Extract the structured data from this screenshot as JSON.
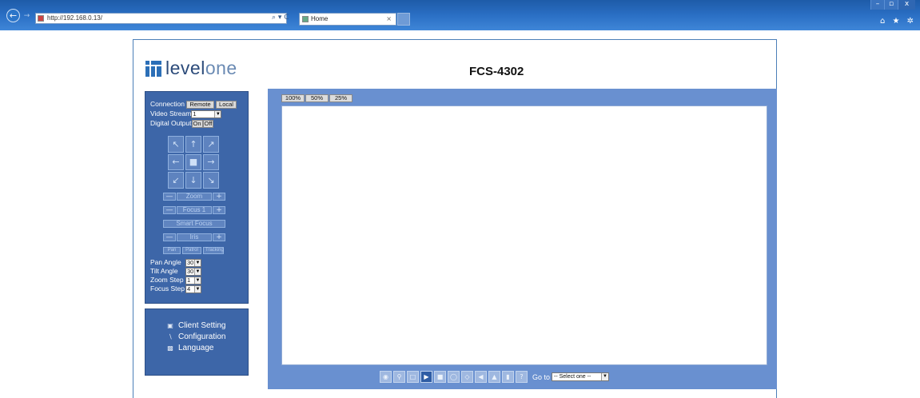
{
  "browser": {
    "url": "http://192.168.0.13/",
    "address_tools": "⌕ ▾ C",
    "tab_title": "Home",
    "tab_close": "×",
    "back_icon": "back-arrow-icon",
    "window_controls": {
      "minimize": "–",
      "maximize": "▫",
      "close": "x"
    },
    "right_icons": "⌂ ★ ✲"
  },
  "brand": {
    "logo_main": "level",
    "logo_suffix": "one",
    "accent": "#2c6fb7"
  },
  "product_title": "FCS-4302",
  "controls": {
    "connection_label": "Connection",
    "remote_btn": "Remote",
    "local_btn": "Local",
    "video_stream_label": "Video Stream",
    "video_stream_value": "1",
    "digital_output_label": "Digital Output",
    "do_on": "On",
    "do_off": "Off",
    "ptz_icons": [
      "↖",
      "↑",
      "↗",
      "←",
      "■",
      "→",
      "↙",
      "↓",
      "↘"
    ],
    "zoom_label": "Zoom",
    "focus_label": "Focus 1",
    "smart_focus_label": "Smart Focus",
    "iris_label": "Iris",
    "minus": "—",
    "plus": "+",
    "modes": [
      "Pan",
      "Patrol",
      "Tracking"
    ],
    "pan_angle_label": "Pan Angle",
    "pan_angle_value": "30",
    "tilt_angle_label": "Tilt Angle",
    "tilt_angle_value": "30",
    "zoom_step_label": "Zoom Step",
    "zoom_step_value": "1",
    "focus_step_label": "Focus Step",
    "focus_step_value": "4"
  },
  "menu": [
    {
      "label": "Client Setting",
      "icon": "client-setting-icon"
    },
    {
      "label": "Configuration",
      "icon": "configuration-icon"
    },
    {
      "label": "Language",
      "icon": "language-icon"
    }
  ],
  "video": {
    "zoom_options": [
      "100%",
      "50%",
      "25%"
    ],
    "goto_label": "Go to",
    "goto_value": "-- Select one --",
    "toolbar_icons": [
      "snapshot-icon",
      "zoom-icon",
      "fullscreen-icon",
      "play-icon",
      "stop-icon",
      "record-icon",
      "talk-icon",
      "volume-icon",
      "mic-icon",
      "audio-icon",
      "help-icon"
    ]
  }
}
